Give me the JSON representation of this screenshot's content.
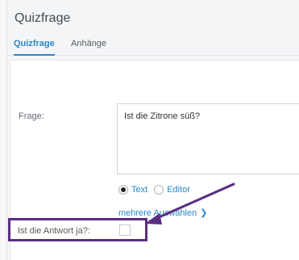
{
  "dialog": {
    "title": "Quizfrage"
  },
  "tabs": [
    {
      "label": "Quizfrage",
      "active": true
    },
    {
      "label": "Anhänge",
      "active": false
    }
  ],
  "question": {
    "label": "Frage:",
    "value": "Ist die Zitrone süß?"
  },
  "format": {
    "options": [
      {
        "label": "Text",
        "checked": true
      },
      {
        "label": "Editor",
        "checked": false
      }
    ]
  },
  "multi_select_link": {
    "label": "mehrere Auswählen"
  },
  "answer": {
    "label": "Ist die Antwort ja?:",
    "checked": false
  },
  "colors": {
    "accent": "#2a88c8",
    "annotation": "#5a2d82"
  }
}
